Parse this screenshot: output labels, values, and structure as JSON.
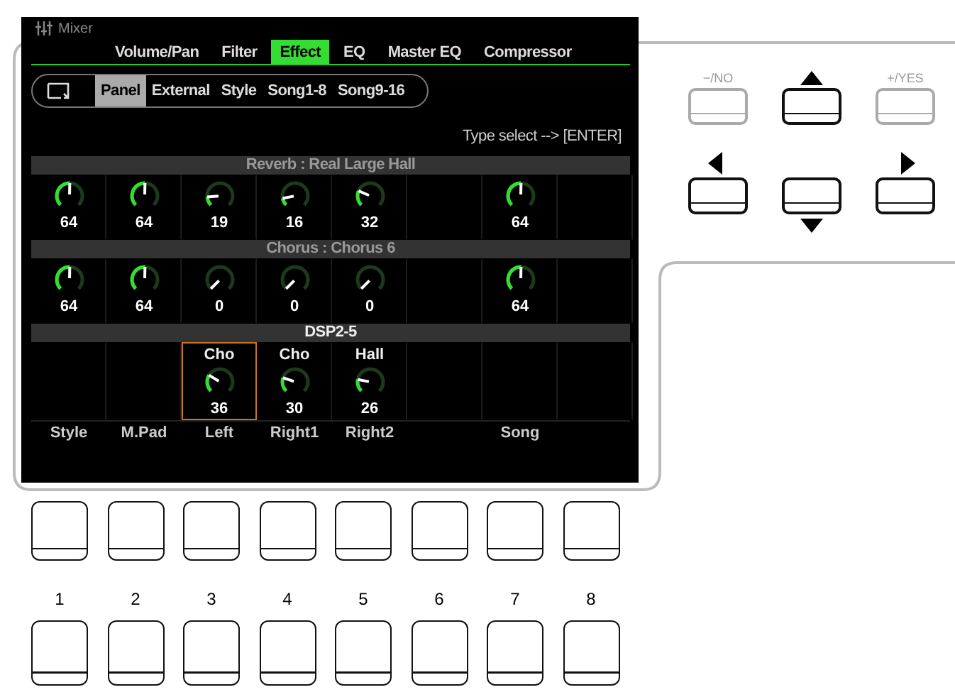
{
  "window": {
    "title": "Mixer"
  },
  "tabs": [
    {
      "label": "Volume/Pan",
      "selected": false
    },
    {
      "label": "Filter",
      "selected": false
    },
    {
      "label": "Effect",
      "selected": true
    },
    {
      "label": "EQ",
      "selected": false
    },
    {
      "label": "Master EQ",
      "selected": false
    },
    {
      "label": "Compressor",
      "selected": false
    }
  ],
  "part_tabs": [
    {
      "label": "Panel",
      "selected": true
    },
    {
      "label": "External",
      "selected": false
    },
    {
      "label": "Style",
      "selected": false
    },
    {
      "label": "Song1-8",
      "selected": false
    },
    {
      "label": "Song9-16",
      "selected": false
    }
  ],
  "hint": "Type select --> [ENTER]",
  "sections": [
    {
      "title": "Reverb : Real Large Hall",
      "active": false,
      "cells": [
        {
          "kind": "knob",
          "value": "64"
        },
        {
          "kind": "knob",
          "value": "64"
        },
        {
          "kind": "knob",
          "value": "19"
        },
        {
          "kind": "knob",
          "value": "16"
        },
        {
          "kind": "knob",
          "value": "32"
        },
        {
          "kind": "empty"
        },
        {
          "kind": "knob",
          "value": "64"
        },
        {
          "kind": "empty"
        }
      ]
    },
    {
      "title": "Chorus : Chorus 6",
      "active": false,
      "cells": [
        {
          "kind": "knob",
          "value": "64"
        },
        {
          "kind": "knob",
          "value": "64"
        },
        {
          "kind": "knob",
          "value": "0"
        },
        {
          "kind": "knob",
          "value": "0"
        },
        {
          "kind": "knob",
          "value": "0"
        },
        {
          "kind": "empty"
        },
        {
          "kind": "knob",
          "value": "64"
        },
        {
          "kind": "empty"
        }
      ]
    },
    {
      "title": "DSP2-5",
      "active": true,
      "cells": [
        {
          "kind": "empty",
          "selected": false
        },
        {
          "kind": "empty",
          "selected": false
        },
        {
          "kind": "knob",
          "type": "Cho",
          "value": "36",
          "selected": true
        },
        {
          "kind": "knob",
          "type": "Cho",
          "value": "30",
          "selected": false
        },
        {
          "kind": "knob",
          "type": "Hall",
          "value": "26",
          "selected": false
        },
        {
          "kind": "empty",
          "selected": false
        },
        {
          "kind": "empty",
          "selected": false
        },
        {
          "kind": "empty",
          "selected": false
        }
      ]
    }
  ],
  "channels": [
    {
      "kind": "label",
      "label": "Style"
    },
    {
      "kind": "label",
      "label": "M.Pad"
    },
    {
      "kind": "label",
      "label": "Left"
    },
    {
      "kind": "label",
      "label": "Right1"
    },
    {
      "kind": "label",
      "label": "Right2"
    },
    {
      "kind": "blank"
    },
    {
      "kind": "label",
      "label": "Song"
    },
    {
      "kind": "blank"
    }
  ],
  "nav_buttons": [
    {
      "kind": "text",
      "label": "−/NO",
      "enabled": false
    },
    {
      "kind": "up",
      "enabled": true
    },
    {
      "kind": "text",
      "label": "+/YES",
      "enabled": false
    },
    {
      "kind": "left",
      "enabled": true
    },
    {
      "kind": "down",
      "enabled": true
    },
    {
      "kind": "right",
      "enabled": true
    }
  ],
  "number_buttons": [
    "1",
    "2",
    "3",
    "4",
    "5",
    "6",
    "7",
    "8"
  ]
}
